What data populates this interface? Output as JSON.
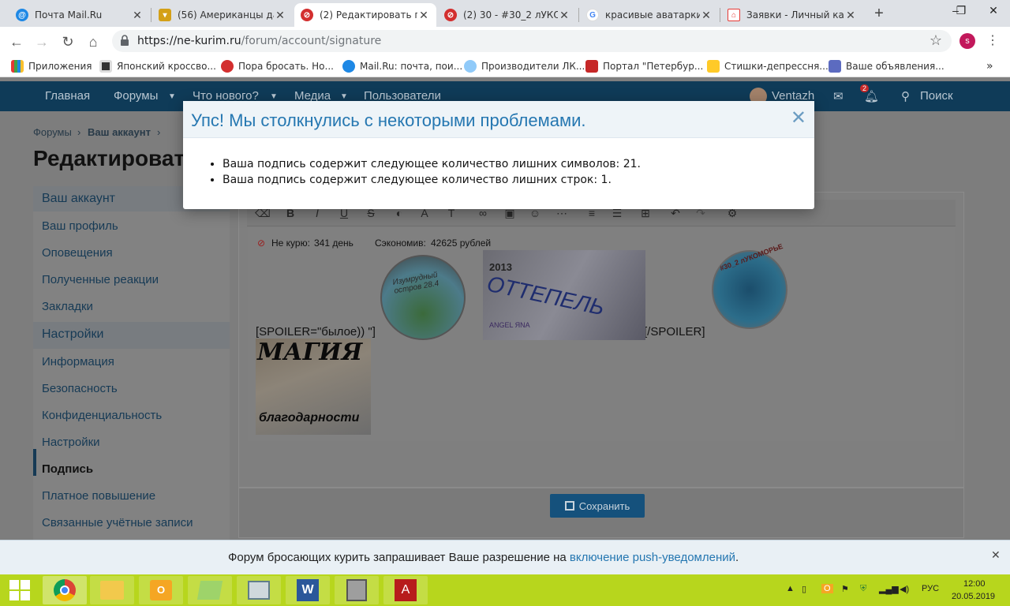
{
  "browser": {
    "tabs": [
      {
        "title": "Почта Mail.Ru",
        "icon": "mail-ru-icon",
        "color": "#1e88e5"
      },
      {
        "title": "(56) Американцы дар",
        "icon": "forum-shield-icon",
        "color": "#d4a017"
      },
      {
        "title": "(2) Редактировать по",
        "icon": "no-smoking-icon",
        "color": "#d32f2f",
        "active": true
      },
      {
        "title": "(2) 30 - #30_2 лУКОМ",
        "icon": "no-smoking-icon",
        "color": "#d32f2f"
      },
      {
        "title": "красивые аватарки д",
        "icon": "google-icon",
        "color": "#4285f4"
      },
      {
        "title": "Заявки - Личный каб",
        "icon": "house-icon",
        "color": "#e53935"
      }
    ],
    "url_host": "https://ne-kurim.ru",
    "url_path": "/forum/account/signature",
    "profile_letter": "s",
    "bookmarks": [
      "Приложения",
      "Японский кроссво...",
      "Пора бросать. Но...",
      "Mail.Ru: почта, пои...",
      "Производители ЛК...",
      "Портал \"Петербур...",
      "Стишки-депрессня...",
      "Ваше объявления..."
    ]
  },
  "site": {
    "nav": [
      "Главная",
      "Форумы",
      "Что нового?",
      "Медиа",
      "Пользователи"
    ],
    "username": "Ventazh",
    "alert_count": "2",
    "search_label": "Поиск",
    "breadcrumb": [
      "Форумы",
      "Ваш аккаунт"
    ],
    "page_title": "Редактироват",
    "sidebar": {
      "account_header": "Ваш аккаунт",
      "account_items": [
        "Ваш профиль",
        "Оповещения",
        "Полученные реакции",
        "Закладки"
      ],
      "settings_header": "Настройки",
      "settings_items": [
        "Информация",
        "Безопасность",
        "Конфиденциальность",
        "Настройки",
        "Подпись",
        "Платное повышение",
        "Связанные учётные записи"
      ]
    },
    "signature": {
      "line1_label": "Не курю:",
      "line1_value": "341 день",
      "line2_label": "Сэкономив:",
      "line2_value": "42625 рублей",
      "spoiler_open": "[SPOILER=\"былое)) \"]",
      "spoiler_close": "[/SPOILER]",
      "img1_text": "Изумрудный остров 28.4",
      "img2_text": "ОТТЕПЕЛЬ",
      "img2_year": "2013",
      "img2_sub": "ANGEL ЯNA",
      "img3_text": "#30_2 лУКОМОРЬЕ",
      "magic_top": "МАГИЯ",
      "magic_bottom": "благодарности"
    },
    "save_label": "Сохранить"
  },
  "modal": {
    "title": "Упс! Мы столкнулись с некоторыми проблемами.",
    "errors": [
      "Ваша подпись содержит следующее количество лишних символов: 21.",
      "Ваша подпись содержит следующее количество лишних строк: 1."
    ]
  },
  "push": {
    "text": "Форум бросающих курить запрашивает Ваше разрешение на ",
    "link": "включение push-уведомлений",
    "end": "."
  },
  "taskbar": {
    "lang": "РУС",
    "time": "12:00",
    "date": "20.05.2019"
  }
}
